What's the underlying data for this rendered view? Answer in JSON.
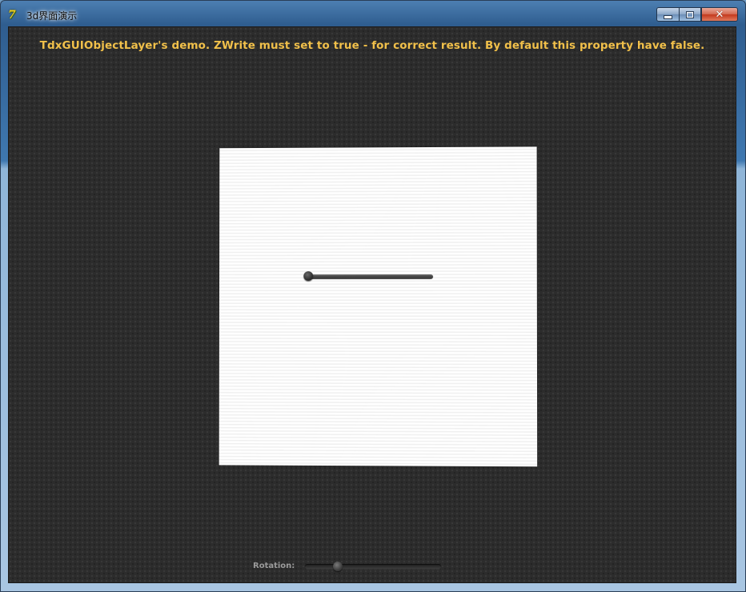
{
  "window": {
    "title": "3d界面演示",
    "icon": "delphi-app-icon",
    "icon_glyph": "7"
  },
  "caption_buttons": {
    "minimize_icon": "minimize-icon",
    "maximize_icon": "maximize-icon",
    "close_icon": "close-icon",
    "close_glyph": "✕"
  },
  "main": {
    "headline": "TdxGUIObjectLayer's demo. ZWrite must set to true - for correct result. By default this property have false.",
    "headline_color": "#f1c04a",
    "panel": {
      "slider_value": 0.0
    },
    "rotation": {
      "label": "Rotation:",
      "value": 0.22
    }
  },
  "colors": {
    "client_bg": "#2c2c2c",
    "panel_bg": "#f7f7f7",
    "accent_text": "#f1c04a"
  }
}
